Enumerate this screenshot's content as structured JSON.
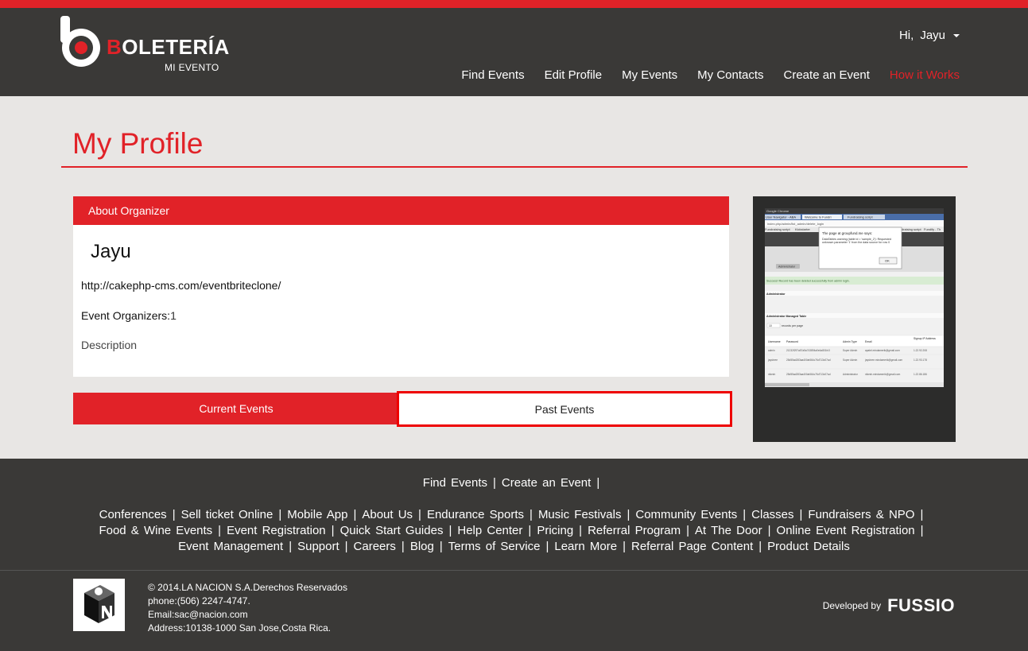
{
  "brand": {
    "name_first": "B",
    "name_rest": "OLETERÍA",
    "tagline": "MI EVENTO",
    "accent": "#e12228",
    "dark": "#3a3937"
  },
  "user": {
    "greeting": "Hi,",
    "name": "Jayu"
  },
  "nav": {
    "items": [
      {
        "label": "Find Events"
      },
      {
        "label": "Edit Profile"
      },
      {
        "label": "My Events"
      },
      {
        "label": "My Contacts"
      },
      {
        "label": "Create an Event"
      },
      {
        "label": "How it Works",
        "active": true
      }
    ]
  },
  "page": {
    "title": "My Profile"
  },
  "organizer": {
    "panel_title": "About Organizer",
    "name": "Jayu",
    "url": "http://cakephp-cms.com/eventbriteclone/",
    "count_label": "Event Organizers:",
    "count_value": "1",
    "description": "Description"
  },
  "tabs": {
    "current": "Current Events",
    "past": "Past Events"
  },
  "thumbnail": {
    "titlebar": "Google Chrome",
    "tab1": "User Navigator - ABA",
    "tab2": "Welcome to Fundri",
    "tab3": "Fundraising script",
    "address": "index.php/admin/list_admin/delete_login",
    "bm1": "Fundraising script",
    "bm2": "Kickstarter",
    "bm3": "Fundraising script",
    "bm4": "Fundify - Th",
    "dialog_title": "The page at groupfund.me says:",
    "dialog_body": "DataTables warning (table id = 'sample_2'): Requested unknown parameter '1' from the data source for row 0",
    "dialog_ok": "OK",
    "breadcrumb": "Administrator",
    "success": "Success! Record has been deleted successfully from admin login.",
    "section1": "Administrator",
    "section2": "Administrator Managed Table",
    "records": "records per page",
    "records_select": "10",
    "columns": [
      "Username",
      "Password",
      "Admin Type",
      "Email",
      "Signup IP Address"
    ],
    "rows": [
      [
        "admin",
        "21232f297a57a5a743894a0e4a801fc3",
        "Super Admin",
        "apatel.mindamerik@gmail.com",
        "1.22.92.208"
      ],
      [
        "jayshree",
        "25d55ad283aa400af464c76d713c07ad",
        "Super Admin",
        "jayshree.mindamerik@gmail.com",
        "1.22.93.178"
      ],
      [
        "nikesh",
        "25d55ad283aa400af464c76d713c07ad",
        "Administrator",
        "nikesh.mindamerik@gmail.com",
        "1.22.86.186"
      ]
    ]
  },
  "footer": {
    "row1": [
      "Find Events",
      "Create an Event"
    ],
    "row2": [
      "Conferences",
      "Sell ticket Online",
      "Mobile App",
      "About Us",
      "Endurance Sports",
      "Music Festivals",
      "Community Events",
      "Classes",
      "Fundraisers & NPO"
    ],
    "row3": [
      "Food & Wine Events",
      "Event Registration",
      "Quick Start Guides",
      "Help Center",
      "Pricing",
      "Referral Program",
      "At The Door",
      "Online Event Registration"
    ],
    "row4": [
      "Event Management",
      "Support",
      "Careers",
      "Blog",
      "Terms of Service",
      "Learn More",
      "Referral Page Content",
      "Product Details"
    ],
    "copyright": "© 2014.LA NACION S.A.Derechos Reservados",
    "phone": "phone:(506) 2247-4747.",
    "email": "Email:sac@nacion.com",
    "address": "Address:10138-1000 San Jose,Costa Rica.",
    "developed_by": "Developed by",
    "developer": "FUSSIO"
  }
}
